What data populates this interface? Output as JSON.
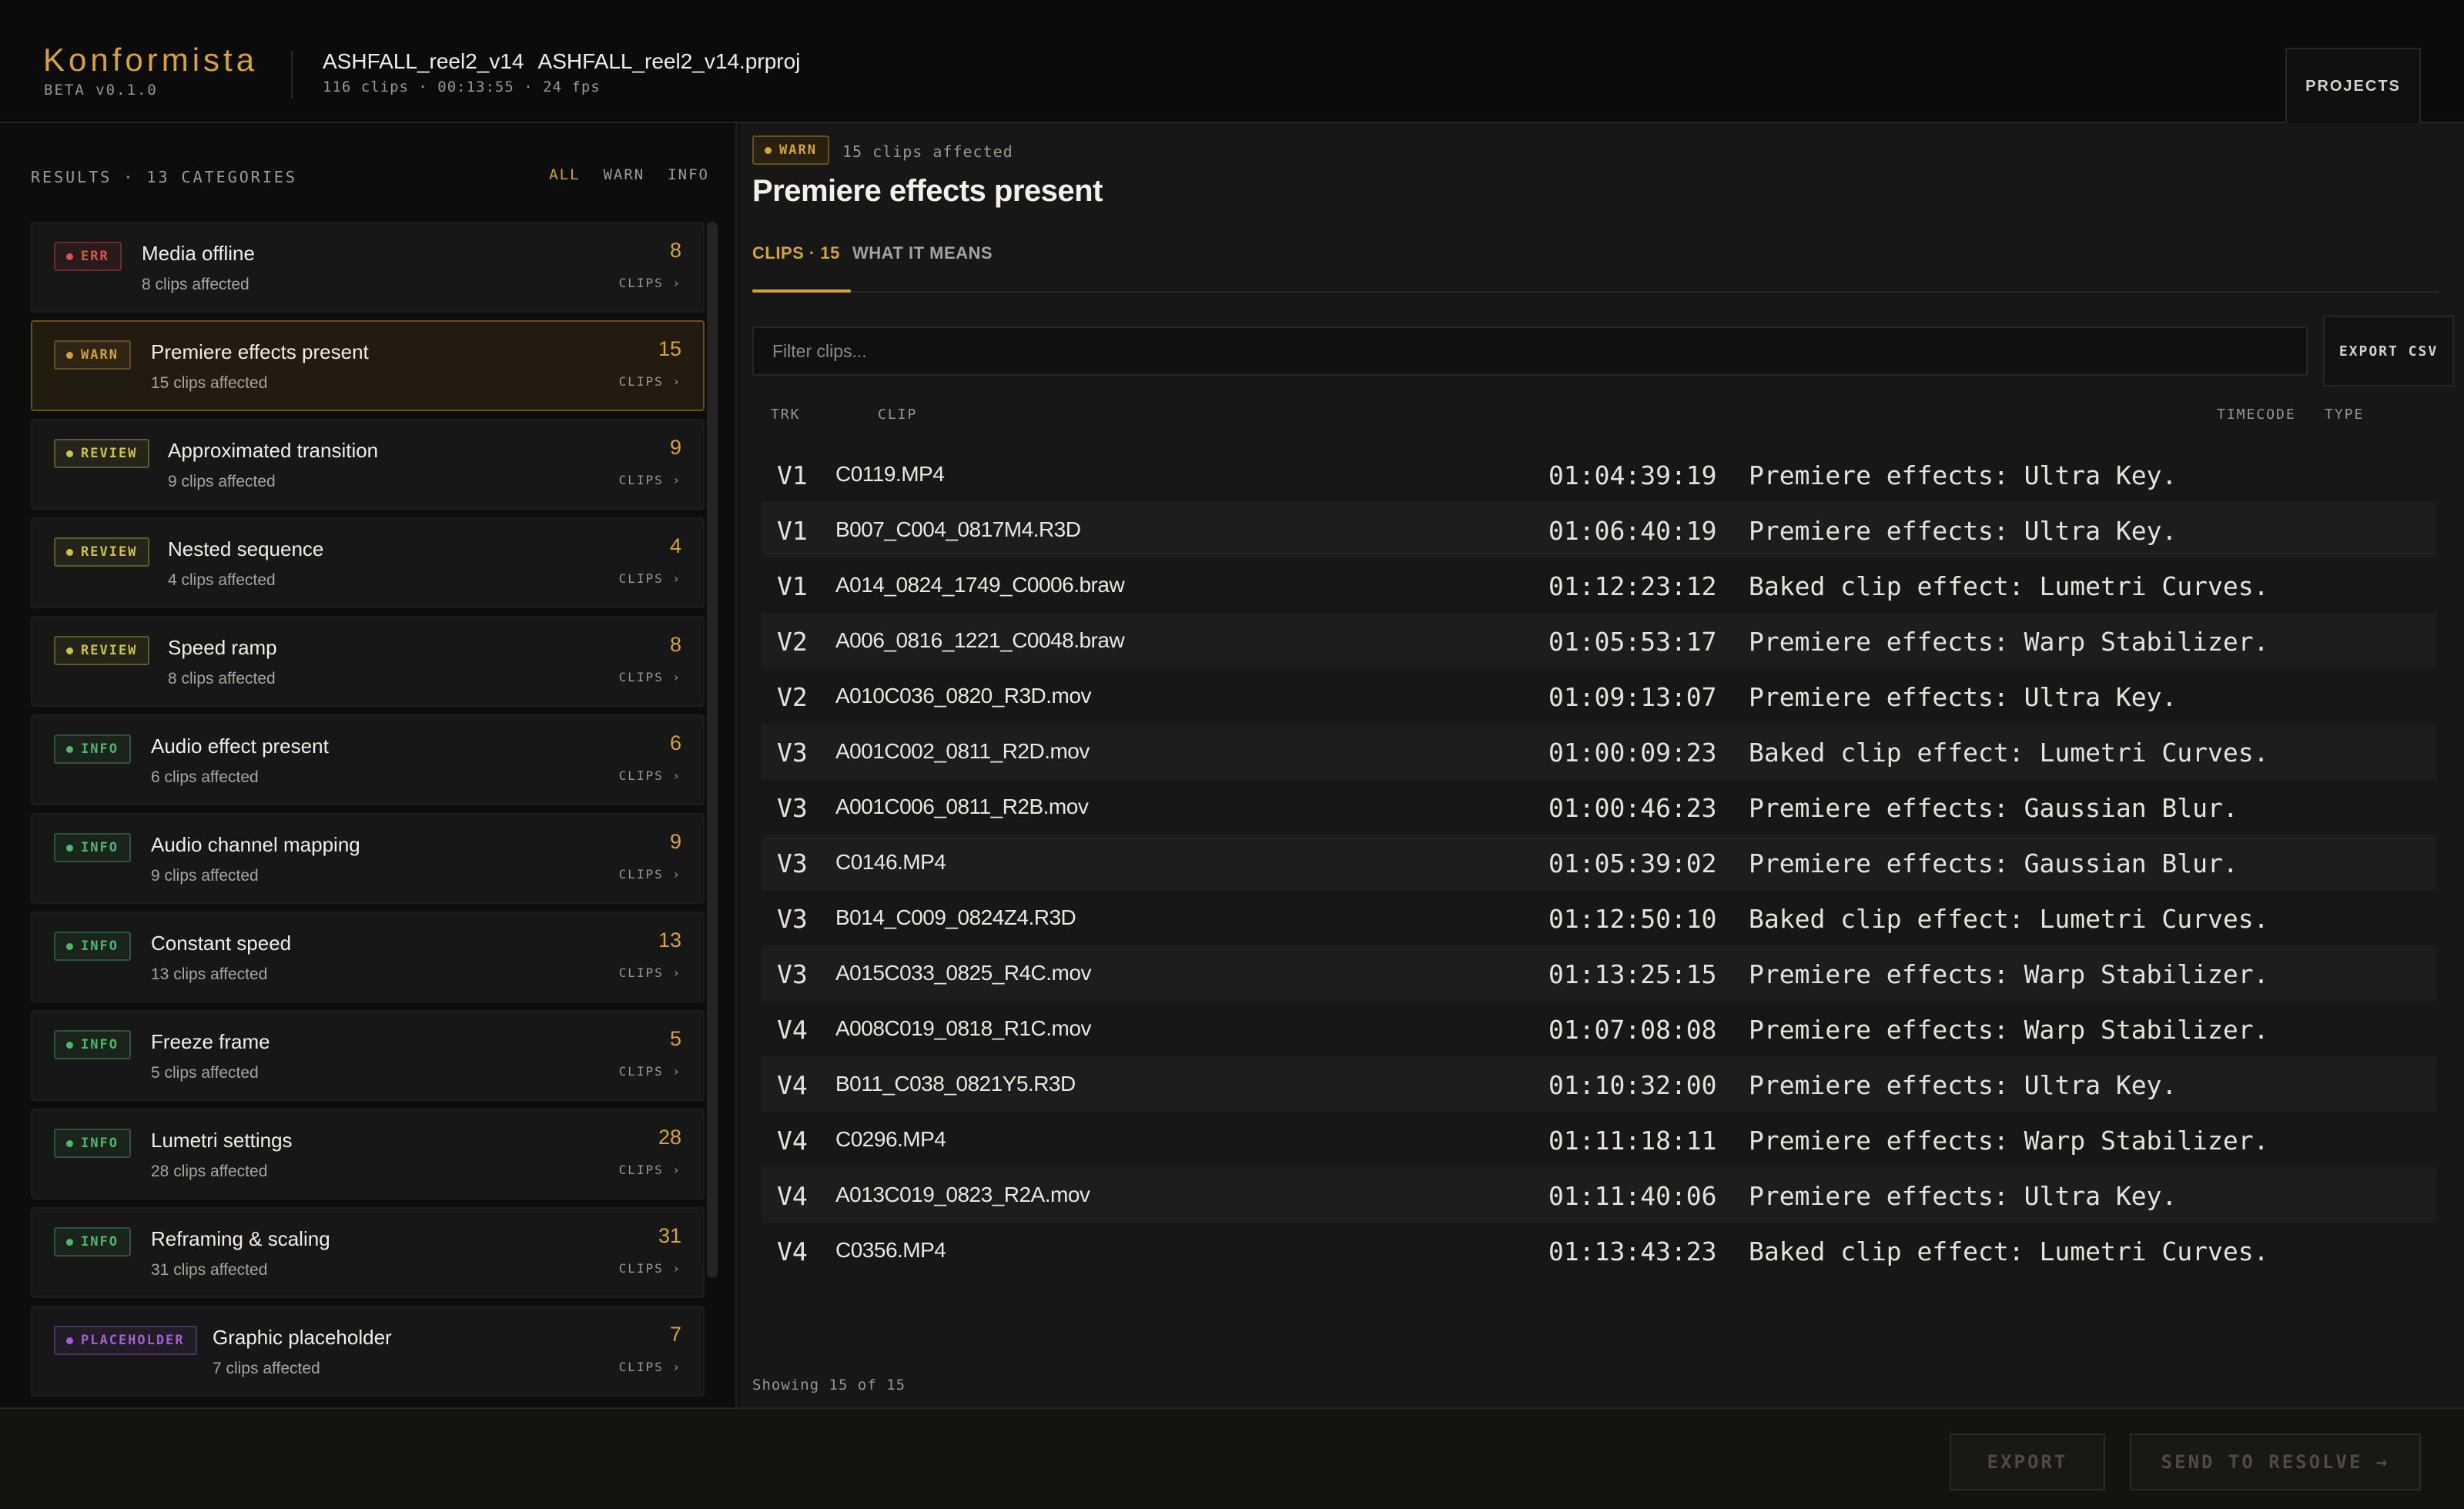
{
  "app": {
    "brand": "Konformista",
    "version": "BETA v0.1.0"
  },
  "project": {
    "name": "ASHFALL_reel2_v14",
    "file": "ASHFALL_reel2_v14.prproj",
    "meta": "116 clips · 00:13:55 · 24 fps"
  },
  "header": {
    "projects_label": "PROJECTS"
  },
  "results": {
    "label": "RESULTS · 13 CATEGORIES",
    "filters": [
      "ALL",
      "WARN",
      "INFO"
    ],
    "active_filter": "ALL"
  },
  "severity_colors": {
    "ERR": "#e0524f",
    "WARN": "#d6a23c",
    "REVIEW": "#cfc24a",
    "INFO": "#4fb86a",
    "PLACEHOLDER": "#a35fd6"
  },
  "categories": [
    {
      "severity": "ERR",
      "title": "Media offline",
      "subtitle": "8 clips affected",
      "count": "8",
      "clips_label": "CLIPS ›"
    },
    {
      "severity": "WARN",
      "title": "Premiere effects present",
      "subtitle": "15 clips affected",
      "count": "15",
      "clips_label": "CLIPS ›",
      "selected": true
    },
    {
      "severity": "REVIEW",
      "title": "Approximated transition",
      "subtitle": "9 clips affected",
      "count": "9",
      "clips_label": "CLIPS ›"
    },
    {
      "severity": "REVIEW",
      "title": "Nested sequence",
      "subtitle": "4 clips affected",
      "count": "4",
      "clips_label": "CLIPS ›"
    },
    {
      "severity": "REVIEW",
      "title": "Speed ramp",
      "subtitle": "8 clips affected",
      "count": "8",
      "clips_label": "CLIPS ›"
    },
    {
      "severity": "INFO",
      "title": "Audio effect present",
      "subtitle": "6 clips affected",
      "count": "6",
      "clips_label": "CLIPS ›"
    },
    {
      "severity": "INFO",
      "title": "Audio channel mapping",
      "subtitle": "9 clips affected",
      "count": "9",
      "clips_label": "CLIPS ›"
    },
    {
      "severity": "INFO",
      "title": "Constant speed",
      "subtitle": "13 clips affected",
      "count": "13",
      "clips_label": "CLIPS ›"
    },
    {
      "severity": "INFO",
      "title": "Freeze frame",
      "subtitle": "5 clips affected",
      "count": "5",
      "clips_label": "CLIPS ›"
    },
    {
      "severity": "INFO",
      "title": "Lumetri settings",
      "subtitle": "28 clips affected",
      "count": "28",
      "clips_label": "CLIPS ›"
    },
    {
      "severity": "INFO",
      "title": "Reframing & scaling",
      "subtitle": "31 clips affected",
      "count": "31",
      "clips_label": "CLIPS ›"
    },
    {
      "severity": "PLACEHOLDER",
      "title": "Graphic placeholder",
      "subtitle": "7 clips affected",
      "count": "7",
      "clips_label": "CLIPS ›"
    }
  ],
  "detail": {
    "severity": "WARN",
    "affected": "15 clips affected",
    "title": "Premiere effects present",
    "tabs": [
      "CLIPS · 15",
      "WHAT IT MEANS"
    ],
    "filter_placeholder": "Filter clips...",
    "export_csv_label": "EXPORT CSV",
    "columns": [
      "TRK",
      "CLIP",
      "TIMECODE",
      "TYPE"
    ],
    "rows": [
      {
        "trk": "V1",
        "clip": "C0119.MP4",
        "timecode": "01:04:39:19",
        "type": "Premiere effects: Ultra Key."
      },
      {
        "trk": "V1",
        "clip": "B007_C004_0817M4.R3D",
        "timecode": "01:06:40:19",
        "type": "Premiere effects: Ultra Key."
      },
      {
        "trk": "V1",
        "clip": "A014_0824_1749_C0006.braw",
        "timecode": "01:12:23:12",
        "type": "Baked clip effect: Lumetri Curves."
      },
      {
        "trk": "V2",
        "clip": "A006_0816_1221_C0048.braw",
        "timecode": "01:05:53:17",
        "type": "Premiere effects: Warp Stabilizer."
      },
      {
        "trk": "V2",
        "clip": "A010C036_0820_R3D.mov",
        "timecode": "01:09:13:07",
        "type": "Premiere effects: Ultra Key."
      },
      {
        "trk": "V3",
        "clip": "A001C002_0811_R2D.mov",
        "timecode": "01:00:09:23",
        "type": "Baked clip effect: Lumetri Curves."
      },
      {
        "trk": "V3",
        "clip": "A001C006_0811_R2B.mov",
        "timecode": "01:00:46:23",
        "type": "Premiere effects: Gaussian Blur."
      },
      {
        "trk": "V3",
        "clip": "C0146.MP4",
        "timecode": "01:05:39:02",
        "type": "Premiere effects: Gaussian Blur."
      },
      {
        "trk": "V3",
        "clip": "B014_C009_0824Z4.R3D",
        "timecode": "01:12:50:10",
        "type": "Baked clip effect: Lumetri Curves."
      },
      {
        "trk": "V3",
        "clip": "A015C033_0825_R4C.mov",
        "timecode": "01:13:25:15",
        "type": "Premiere effects: Warp Stabilizer."
      },
      {
        "trk": "V4",
        "clip": "A008C019_0818_R1C.mov",
        "timecode": "01:07:08:08",
        "type": "Premiere effects: Warp Stabilizer."
      },
      {
        "trk": "V4",
        "clip": "B011_C038_0821Y5.R3D",
        "timecode": "01:10:32:00",
        "type": "Premiere effects: Ultra Key."
      },
      {
        "trk": "V4",
        "clip": "C0296.MP4",
        "timecode": "01:11:18:11",
        "type": "Premiere effects: Warp Stabilizer."
      },
      {
        "trk": "V4",
        "clip": "A013C019_0823_R2A.mov",
        "timecode": "01:11:40:06",
        "type": "Premiere effects: Ultra Key."
      },
      {
        "trk": "V4",
        "clip": "C0356.MP4",
        "timecode": "01:13:43:23",
        "type": "Baked clip effect: Lumetri Curves."
      }
    ],
    "showing": "Showing 15 of 15"
  },
  "footer": {
    "export_label": "EXPORT",
    "send_label": "SEND TO RESOLVE →"
  }
}
